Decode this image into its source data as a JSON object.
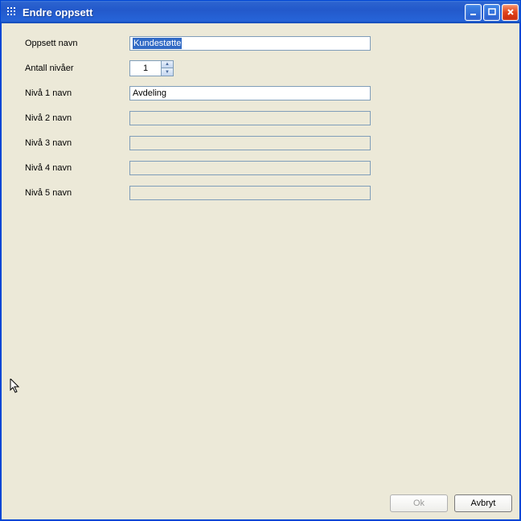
{
  "window": {
    "title": "Endre oppsett"
  },
  "form": {
    "oppsett_label": "Oppsett navn",
    "oppsett_value": "Kundestøtte",
    "antall_label": "Antall nivåer",
    "antall_value": "1",
    "niva1_label": "Nivå 1 navn",
    "niva1_value": "Avdeling",
    "niva2_label": "Nivå 2 navn",
    "niva2_value": "",
    "niva3_label": "Nivå 3 navn",
    "niva3_value": "",
    "niva4_label": "Nivå 4 navn",
    "niva4_value": "",
    "niva5_label": "Nivå 5 navn",
    "niva5_value": ""
  },
  "buttons": {
    "ok": "Ok",
    "cancel": "Avbryt"
  }
}
